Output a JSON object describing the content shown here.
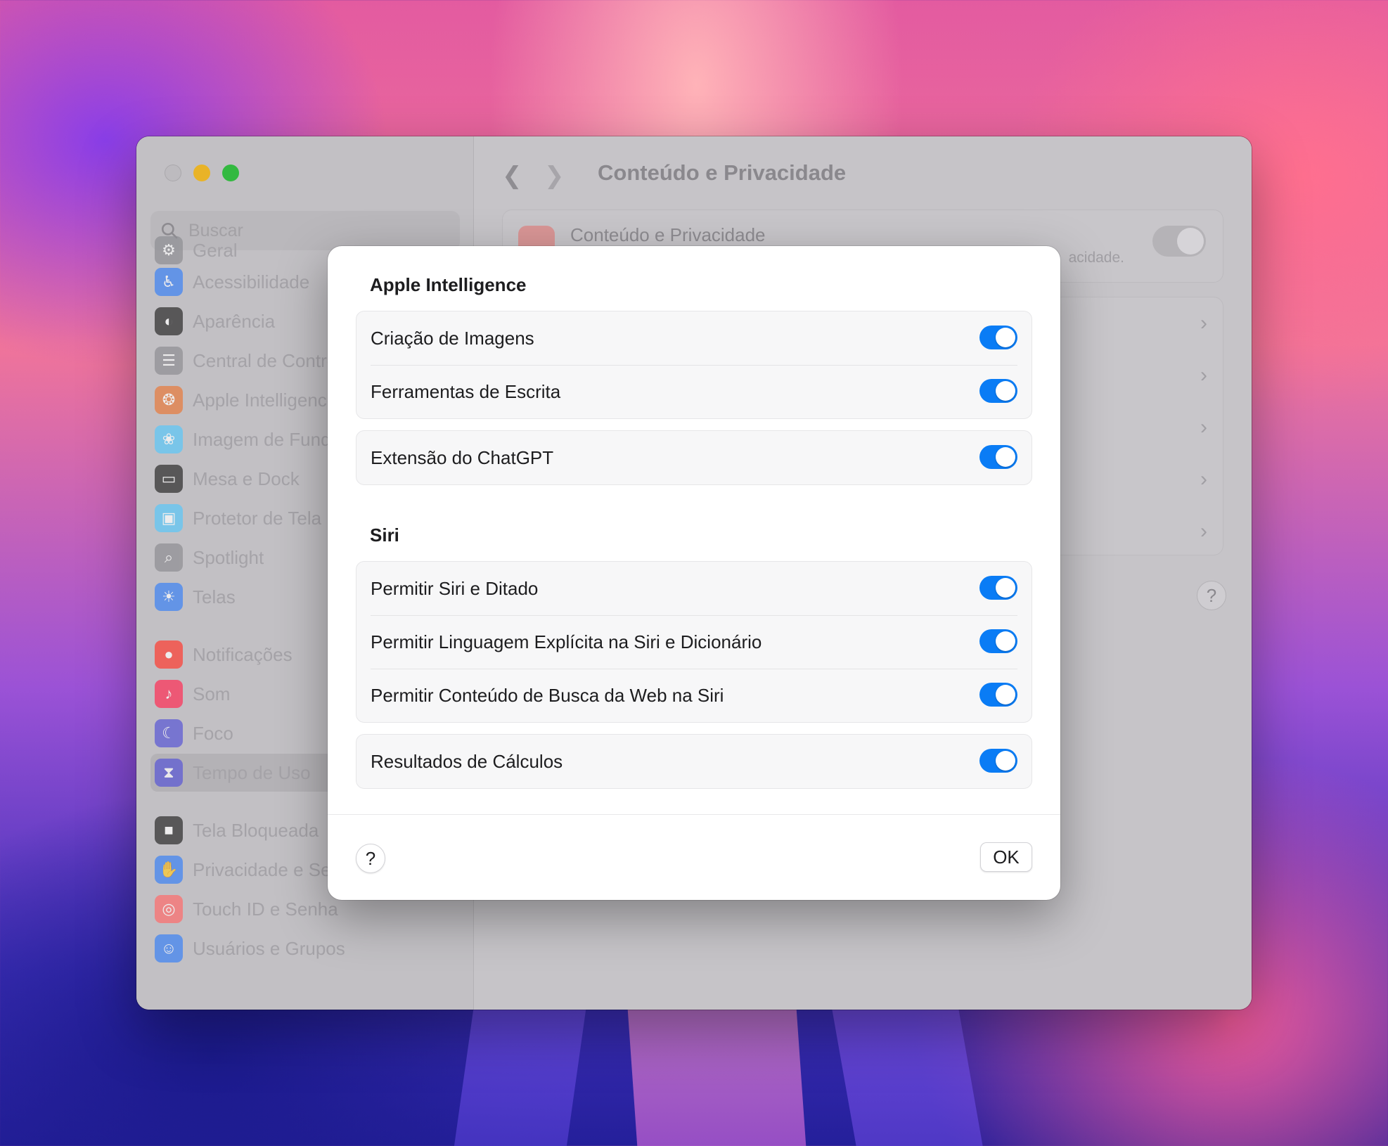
{
  "window": {
    "search_placeholder": "Buscar",
    "title": "Conteúdo e Privacidade"
  },
  "sidebar": {
    "partial_top": "Geral",
    "items": [
      {
        "label": "Acessibilidade",
        "icon": "accessibility-icon",
        "color": "#3b82f6"
      },
      {
        "label": "Aparência",
        "icon": "appearance-icon",
        "color": "#2b2b2b"
      },
      {
        "label": "Central de Controle",
        "icon": "control-center-icon",
        "color": "#8e8e93"
      },
      {
        "label": "Apple Intelligence e Siri",
        "icon": "apple-intelligence-icon",
        "color": "#e8793b"
      },
      {
        "label": "Imagem de Fundo",
        "icon": "wallpaper-icon",
        "color": "#5ac8fa"
      },
      {
        "label": "Mesa e Dock",
        "icon": "dock-icon",
        "color": "#2b2b2b"
      },
      {
        "label": "Protetor de Tela",
        "icon": "screensaver-icon",
        "color": "#5ac8fa"
      },
      {
        "label": "Spotlight",
        "icon": "spotlight-icon",
        "color": "#8e8e93"
      },
      {
        "label": "Telas",
        "icon": "displays-icon",
        "color": "#3b82f6"
      },
      {
        "label": "Notificações",
        "icon": "notifications-icon",
        "color": "#ff3b30"
      },
      {
        "label": "Som",
        "icon": "sound-icon",
        "color": "#ff2d55"
      },
      {
        "label": "Foco",
        "icon": "focus-icon",
        "color": "#5856d6"
      },
      {
        "label": "Tempo de Uso",
        "icon": "screen-time-icon",
        "color": "#5856d6",
        "selected": true
      },
      {
        "label": "Tela Bloqueada",
        "icon": "lock-icon",
        "color": "#2b2b2b"
      },
      {
        "label": "Privacidade e Segurança",
        "icon": "privacy-hand-icon",
        "color": "#3b82f6"
      },
      {
        "label": "Touch ID e Senha",
        "icon": "touch-id-icon",
        "color": "#ff6b6b"
      },
      {
        "label": "Usuários e Grupos",
        "icon": "users-icon",
        "color": "#3b82f6"
      }
    ]
  },
  "content": {
    "card_title": "Conteúdo e Privacidade",
    "card_desc_fragment": "acidade."
  },
  "sheet": {
    "section1_title": "Apple Intelligence",
    "group1": [
      "Criação de Imagens",
      "Ferramentas de Escrita"
    ],
    "group2": [
      "Extensão do ChatGPT"
    ],
    "section2_title": "Siri",
    "group3": [
      "Permitir Siri e Ditado",
      "Permitir Linguagem Explícita na Siri e Dicionário",
      "Permitir Conteúdo de Busca da Web na Siri"
    ],
    "group4": [
      "Resultados de Cálculos"
    ],
    "help_label": "?",
    "ok_label": "OK",
    "toggle_state": "on",
    "accent_color": "#0a7cf5"
  }
}
